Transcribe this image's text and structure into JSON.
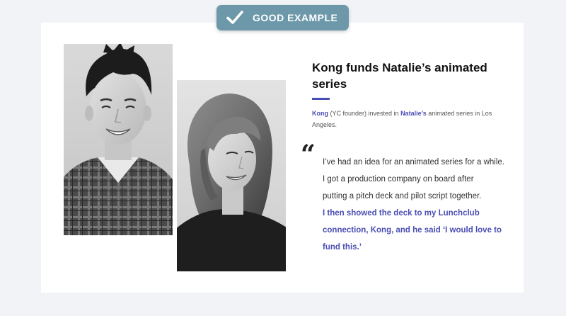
{
  "badge": {
    "label": "GOOD EXAMPLE",
    "icon": "check-icon",
    "color": "#6c98aa"
  },
  "story": {
    "headline": "Kong funds Natalie’s animated series",
    "summary": {
      "name_1": "Kong",
      "mid_1": " (YC founder) invested in ",
      "name_2": "Natalie’s",
      "end": " animated series in Los Angeles."
    },
    "quote_mark": "“",
    "quote_lines": [
      "I’ve had an idea for an animated series for a while.",
      "I got a production company on board after",
      "putting a pitch deck and pilot script together."
    ],
    "quote_highlight_lines": [
      "I then showed the deck to my Lunchclub",
      "connection, Kong, and he said ‘I would love to",
      "fund this.’"
    ],
    "accent_color": "#4b4fb3"
  },
  "photos": [
    {
      "icon": "portrait-kong"
    },
    {
      "icon": "portrait-natalie"
    }
  ]
}
